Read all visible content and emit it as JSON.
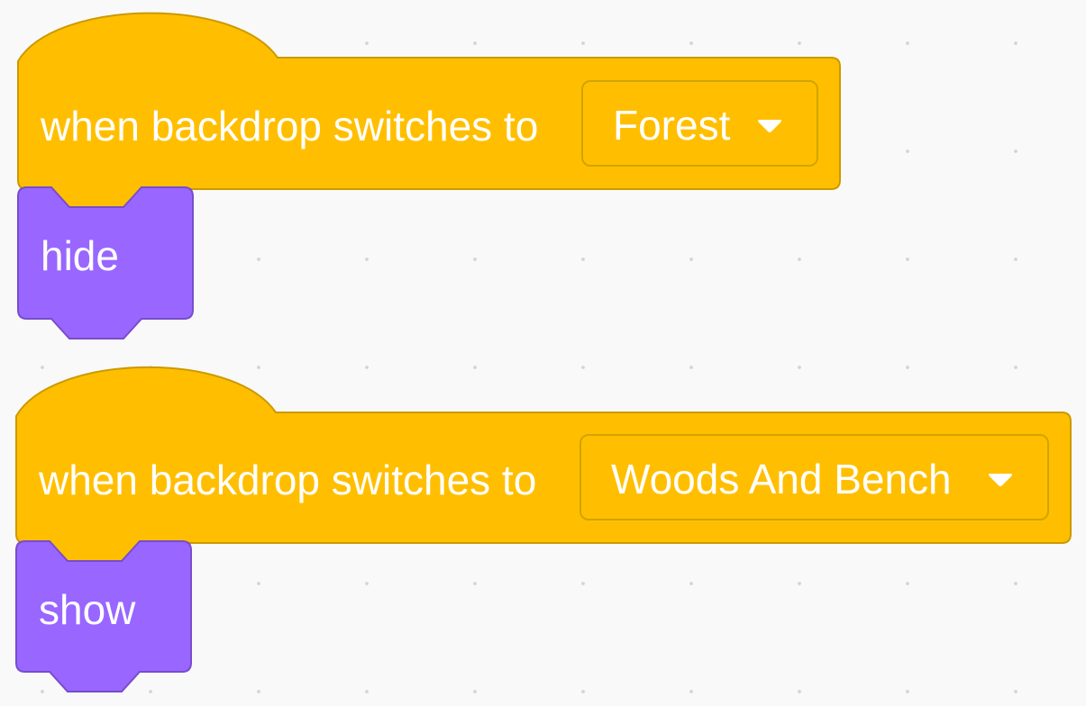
{
  "scripts": [
    {
      "hat": {
        "label": "when backdrop switches to",
        "backdrop_value": "Forest",
        "dropdown_icon": "triangle-down-icon"
      },
      "command": {
        "label": "hide"
      }
    },
    {
      "hat": {
        "label": "when backdrop switches to",
        "backdrop_value": "Woods And Bench",
        "dropdown_icon": "triangle-down-icon"
      },
      "command": {
        "label": "show"
      }
    }
  ],
  "colors": {
    "events_fill": "#ffbf00",
    "events_stroke": "#cc9900",
    "looks_fill": "#9966ff",
    "looks_stroke": "#774dcb",
    "workspace_bg": "#f9f9f9"
  }
}
